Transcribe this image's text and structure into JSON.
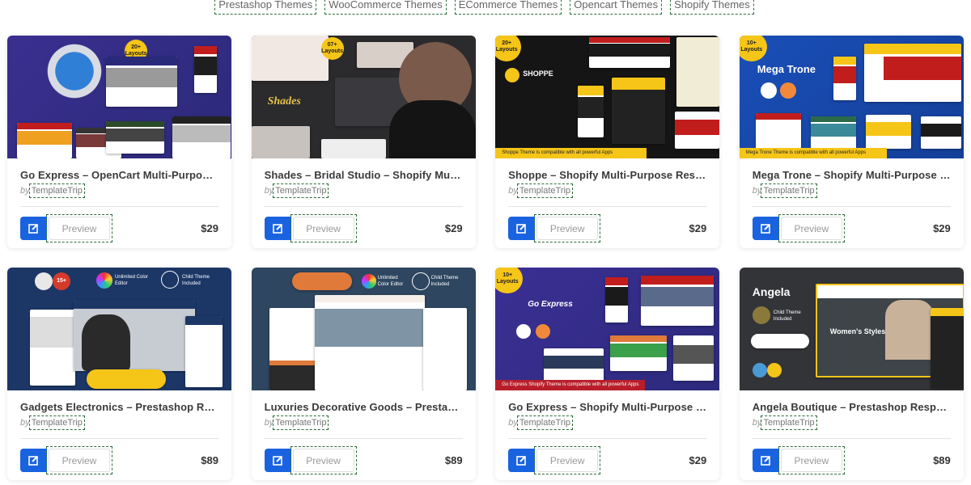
{
  "top_nav": [
    {
      "label": "Prestashop Themes"
    },
    {
      "label": "WooCommerce Themes"
    },
    {
      "label": "ECommerce Themes"
    },
    {
      "label": "Opencart Themes"
    },
    {
      "label": "Shopify Themes"
    }
  ],
  "colors": {
    "accent_blue": "#1a63e0",
    "focus_outline": "#2e6b3a"
  },
  "products": [
    {
      "title": "Go Express – OpenCart Multi-Purpose ...",
      "by": "by",
      "author": "TemplateTrip",
      "preview": "Preview",
      "price": "$29",
      "thumb_badge": "20+ Layouts",
      "thumb_theme": "navy"
    },
    {
      "title": "Shades – Bridal Studio – Shopify Multi-...",
      "by": "by",
      "author": "TemplateTrip",
      "preview": "Preview",
      "price": "$29",
      "thumb_badge": "07+ Layouts",
      "thumb_theme": "dark",
      "thumb_logo": "Shades"
    },
    {
      "title": "Shoppe – Shopify Multi-Purpose Respo...",
      "by": "by",
      "author": "TemplateTrip",
      "preview": "Preview",
      "price": "$29",
      "thumb_badge": "20+ Layouts",
      "thumb_theme": "black-yellow",
      "thumb_logo": "SHOPPE",
      "thumb_strip": "Shoppe Theme is compatible with all powerful Apps"
    },
    {
      "title": "Mega Trone – Shopify Multi-Purpose R...",
      "by": "by",
      "author": "TemplateTrip",
      "preview": "Preview",
      "price": "$29",
      "thumb_badge": "10+ Layouts",
      "thumb_theme": "blue",
      "thumb_logo": "Mega Trone",
      "thumb_strip": "Mega Trone Theme is compatible with all powerful Apps"
    },
    {
      "title": "Gadgets Electronics – Prestashop Resp...",
      "by": "by",
      "author": "TemplateTrip",
      "preview": "Preview",
      "price": "$89",
      "thumb_badge": "15+",
      "thumb_theme": "darkblue",
      "thumb_feature_1": "Unlimited Color Editor",
      "thumb_feature_2": "Child Theme Included"
    },
    {
      "title": "Luxuries Decorative Goods – Prestasho...",
      "by": "by",
      "author": "TemplateTrip",
      "preview": "Preview",
      "price": "$89",
      "thumb_theme": "slate",
      "thumb_feature_1": "Unlimited Color Editor",
      "thumb_feature_2": "Child Theme Included"
    },
    {
      "title": "Go Express – Shopify Multi-Purpose Re...",
      "by": "by",
      "author": "TemplateTrip",
      "preview": "Preview",
      "price": "$29",
      "thumb_badge": "10+ Layouts",
      "thumb_theme": "indigo",
      "thumb_logo": "Go Express",
      "thumb_strip": "Go Express Shopify Theme is compatible with all powerful Apps"
    },
    {
      "title": "Angela Boutique – Prestashop Respon...",
      "by": "by",
      "author": "TemplateTrip",
      "preview": "Preview",
      "price": "$89",
      "thumb_theme": "charcoal",
      "thumb_logo": "Angela",
      "thumb_feature_2": "Child Theme Included",
      "thumb_hero": "Women's Styles"
    }
  ]
}
